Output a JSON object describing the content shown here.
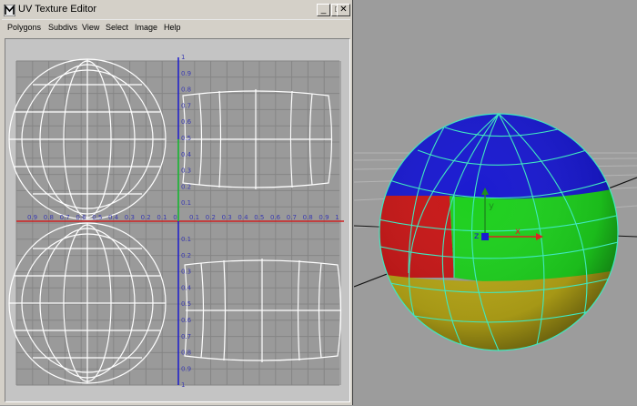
{
  "window": {
    "title": "UV Texture Editor",
    "controls": {
      "minimize": "_",
      "maximize": "□",
      "close": "✕"
    }
  },
  "menu": {
    "items": [
      {
        "label": "Polygons"
      },
      {
        "label": "Subdivs"
      },
      {
        "label": "View"
      },
      {
        "label": "Select"
      },
      {
        "label": "Image"
      },
      {
        "label": "Help"
      }
    ]
  },
  "uv_editor": {
    "axis_h_labels": [
      "0.9",
      "0.8",
      "0.7",
      "0.6",
      "0.5",
      "0.4",
      "0.3",
      "0.2",
      "0.1",
      "0",
      "0.1",
      "0.2",
      "0.3",
      "0.4",
      "0.5",
      "0.6",
      "0.7",
      "0.8",
      "0.9",
      "1"
    ],
    "axis_v_labels_top": [
      "1",
      "0.9",
      "0.8",
      "0.7",
      "0.6",
      "0.5",
      "0.4",
      "0.3",
      "0.2",
      "0.1"
    ],
    "axis_v_labels_bottom": [
      "0.1",
      "0.2",
      "0.3",
      "0.4",
      "0.5",
      "0.6",
      "0.7",
      "0.8",
      "0.9",
      "1"
    ],
    "colors": {
      "grid_bg": "#9a9a9a",
      "grid_line": "#858585",
      "axis_u": "#cc2222",
      "axis_v": "#1a1acc",
      "uv_wire": "#ffffff"
    }
  },
  "viewport": {
    "manipulator": {
      "x": "x",
      "y": "y",
      "z": "z"
    },
    "colors": {
      "top_face": "#1a1ad0",
      "front_face": "#1ed01e",
      "left_face": "#c81818",
      "bottom_face": "#b8a818",
      "wire": "#40e8c0"
    }
  }
}
